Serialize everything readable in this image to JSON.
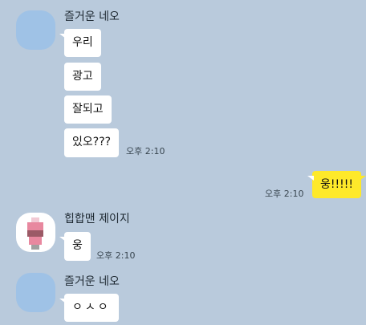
{
  "colors": {
    "background": "#b9cadc",
    "incoming_bubble": "#ffffff",
    "outgoing_bubble": "#fee92a",
    "avatar_default": "#9fc2e6"
  },
  "messages": {
    "group1": {
      "sender": "즐거운 네오",
      "bubbles": [
        "우리",
        "광고",
        "잘되고",
        "있오???"
      ],
      "time": "오후 2:10"
    },
    "me1": {
      "bubble": "웅!!!!!",
      "time": "오후 2:10"
    },
    "group2": {
      "sender": "힙합맨 제이지",
      "bubble": "웅",
      "time": "오후 2:10"
    },
    "group3": {
      "sender": "즐거운 네오",
      "bubble": "ㅇㅅㅇ"
    }
  }
}
